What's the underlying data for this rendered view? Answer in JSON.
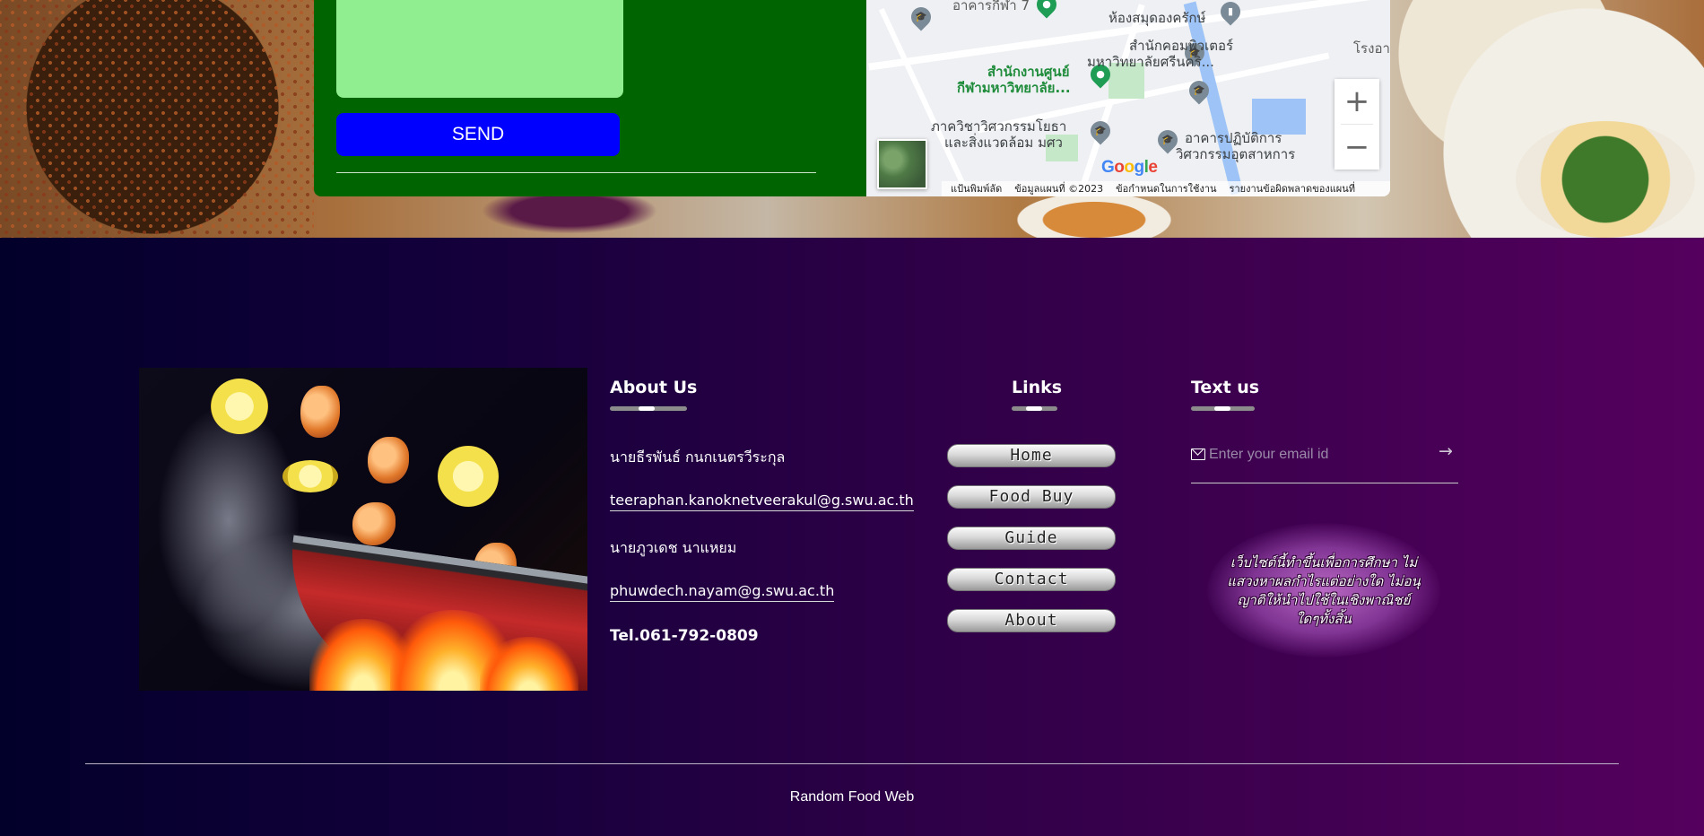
{
  "contact": {
    "message_value": "",
    "send_label": "SEND"
  },
  "map": {
    "labels": [
      "อาคารกีฬา 7",
      "ห้องสมุดองครักษ์",
      "สำนักงานศูนย์",
      "กีฬามหาวิทยาลัย...",
      "สำนักคอมพิวเตอร์",
      "มหาวิทยาลัยศรีนคริ...",
      "ภาควิชาวิศวกรรมโยธา",
      "และสิ่งแวดล้อม มศว",
      "อาคารปฏิบัติการ",
      "วิศวกรรมอุตสาหการ",
      "โรงอา"
    ],
    "zoom_in": "+",
    "zoom_out": "−",
    "attribution": [
      "แป้นพิมพ์ลัด",
      "ข้อมูลแผนที่ ©2023",
      "ข้อกำหนดในการใช้งาน",
      "รายงานข้อผิดพลาดของแผนที่"
    ]
  },
  "footer": {
    "about": {
      "title": "About Us",
      "name1": "นายธีรพันธ์ กนกเนตรวีระกุล",
      "email1": "teeraphan.kanoknetveerakul@g.swu.ac.th",
      "name2": "นายภูวเดช นาแหยม",
      "email2": "phuwdech.nayam@g.swu.ac.th",
      "tel": "Tel.061-792-0809"
    },
    "links": {
      "title": "Links",
      "items": [
        "Home",
        "Food Buy",
        "Guide",
        "Contact",
        "About"
      ]
    },
    "text_us": {
      "title": "Text us",
      "placeholder": "Enter your email id",
      "disclaimer": "เว็บไซต์นี้ทำขึ้นเพื่อการศึกษา ไม่แสวงหาผลกำไรแต่อย่างใด ไม่อนุญาติให้นำไปใช้ในเชิงพาณิชย์ใดๆทั้งสิ้น"
    },
    "copyright": "Random Food Web"
  },
  "icons": {
    "email": "envelope-icon",
    "submit": "arrow-right-icon"
  },
  "colors": {
    "panel_green": "#006400",
    "message_green": "#90ee90",
    "send_blue": "#0000ff",
    "footer_start": "#02002a",
    "footer_end": "#55005e"
  }
}
